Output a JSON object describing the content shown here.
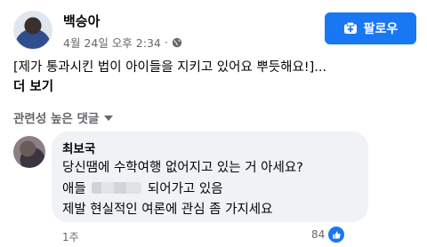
{
  "post": {
    "author": "백승아",
    "date": "4월 24일 오후 2:34",
    "separator": "·",
    "text": "[제가 통과시킨 법이 아이들을 지키고 있어요 뿌듯해요!]...",
    "see_more": "더 보기"
  },
  "follow_button": {
    "label": "팔로우"
  },
  "comments_sort": {
    "label": "관련성 높은 댓글"
  },
  "comment": {
    "author": "최보국",
    "line1": "당신땜에 수학여행 없어지고 있는 거 아세요?",
    "line2_prefix": "애들",
    "line2_suffix": "되어가고 있음",
    "line3": "제발 현실적인 여론에 관심 좀 가지세요",
    "time": "1주",
    "like_count": "84"
  },
  "colors": {
    "accent": "#1877f2",
    "bubble": "#f0f2f5",
    "secondary_text": "#65676b"
  },
  "icons": {
    "globe": "globe-icon",
    "follow": "follow-icon",
    "caret": "caret-down-icon",
    "like": "like-icon"
  }
}
